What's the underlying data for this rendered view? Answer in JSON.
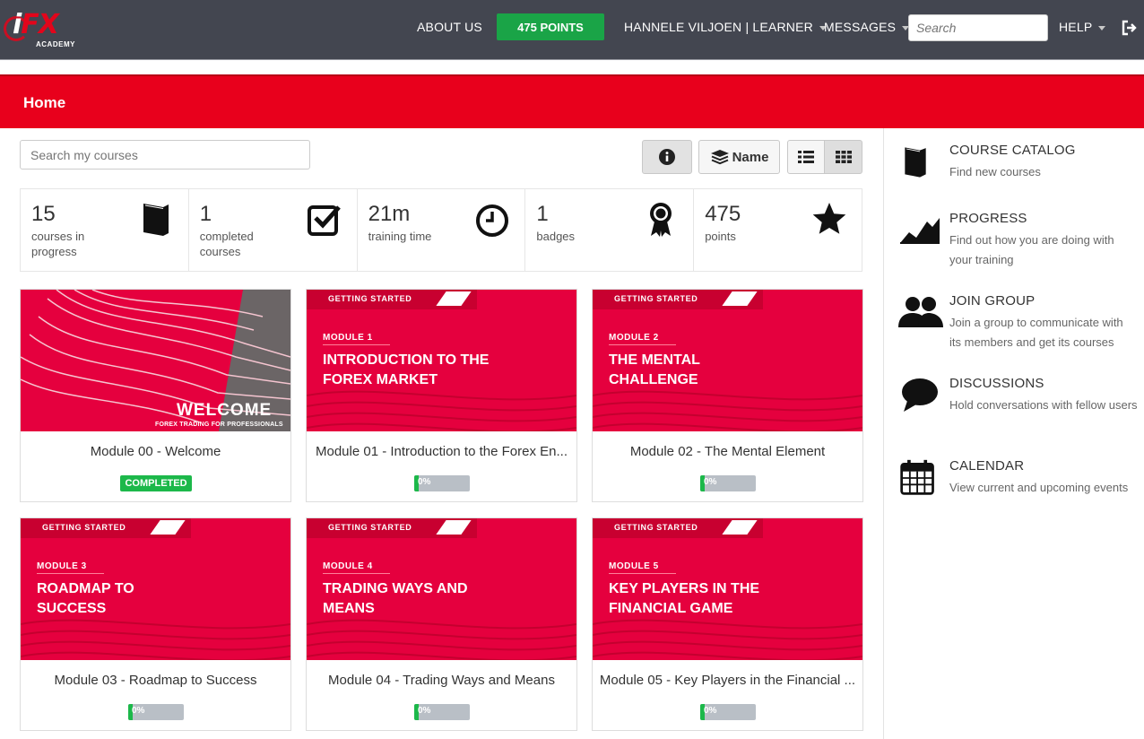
{
  "header": {
    "logo_text": "iFX",
    "logo_sub": "ACADEMY",
    "about": "ABOUT US",
    "points": "475 POINTS",
    "user": "HANNELE VILJOEN | LEARNER",
    "messages": "MESSAGES",
    "search_placeholder": "Search",
    "help": "HELP",
    "icons": {
      "logout": "logout-icon",
      "caret": "caret-down-icon"
    }
  },
  "banner": {
    "title": "Home"
  },
  "controls": {
    "search_placeholder": "Search my courses",
    "sort_label": "Name",
    "icons": [
      "info-icon",
      "layers-icon",
      "list-view-icon",
      "grid-view-icon"
    ]
  },
  "stats": [
    {
      "value": "15",
      "label": "courses in progress",
      "icon": "book-icon"
    },
    {
      "value": "1",
      "label": "completed courses",
      "icon": "checkbox-icon"
    },
    {
      "value": "21m",
      "label": "training time",
      "icon": "clock-icon"
    },
    {
      "value": "1",
      "label": "badges",
      "icon": "badge-icon"
    },
    {
      "value": "475",
      "label": "points",
      "icon": "star-icon"
    }
  ],
  "courses": [
    {
      "caption": "Module 00 - Welcome",
      "status": "COMPLETED",
      "thumb_title": "WELCOME",
      "thumb_sub": "FOREX TRADING FOR PROFESSIONALS"
    },
    {
      "caption": "Module 01 - Introduction to the Forex En...",
      "progress": "0%",
      "progress_value": 0,
      "tag": "GETTING STARTED",
      "module": "MODULE 1",
      "thumb_title": "INTRODUCTION TO THE FOREX MARKET"
    },
    {
      "caption": "Module 02 - The Mental Element",
      "progress": "0%",
      "progress_value": 0,
      "tag": "GETTING STARTED",
      "module": "MODULE 2",
      "thumb_title": "THE MENTAL CHALLENGE"
    },
    {
      "caption": "Module 03 - Roadmap to Success",
      "progress": "0%",
      "progress_value": 0,
      "tag": "GETTING STARTED",
      "module": "MODULE 3",
      "thumb_title": "ROADMAP TO SUCCESS"
    },
    {
      "caption": "Module 04 - Trading Ways and Means",
      "progress": "0%",
      "progress_value": 0,
      "tag": "GETTING STARTED",
      "module": "MODULE 4",
      "thumb_title": "TRADING WAYS AND MEANS"
    },
    {
      "caption": "Module 05 - Key Players in the Financial ...",
      "progress": "0%",
      "progress_value": 0,
      "tag": "GETTING STARTED",
      "module": "MODULE 5",
      "thumb_title": "KEY PLAYERS IN THE FINANCIAL GAME"
    }
  ],
  "sidebar": [
    {
      "title": "COURSE CATALOG",
      "desc": "Find new courses",
      "icon": "book-icon"
    },
    {
      "title": "PROGRESS",
      "desc": "Find out how you are doing with your training",
      "icon": "chart-icon"
    },
    {
      "title": "JOIN GROUP",
      "desc": "Join a group to communicate with its members and get its courses",
      "icon": "group-icon"
    },
    {
      "title": "DISCUSSIONS",
      "desc": "Hold conversations with fellow users",
      "icon": "chat-bubble-icon"
    },
    {
      "title": "CALENDAR",
      "desc": "View current and upcoming events",
      "icon": "calendar-icon"
    }
  ],
  "colors": {
    "header": "#434650",
    "brand_red": "#e8001c",
    "thumb_red": "#e5003e",
    "points_green": "#1aa447",
    "progress_grey": "#b9bfc6"
  }
}
